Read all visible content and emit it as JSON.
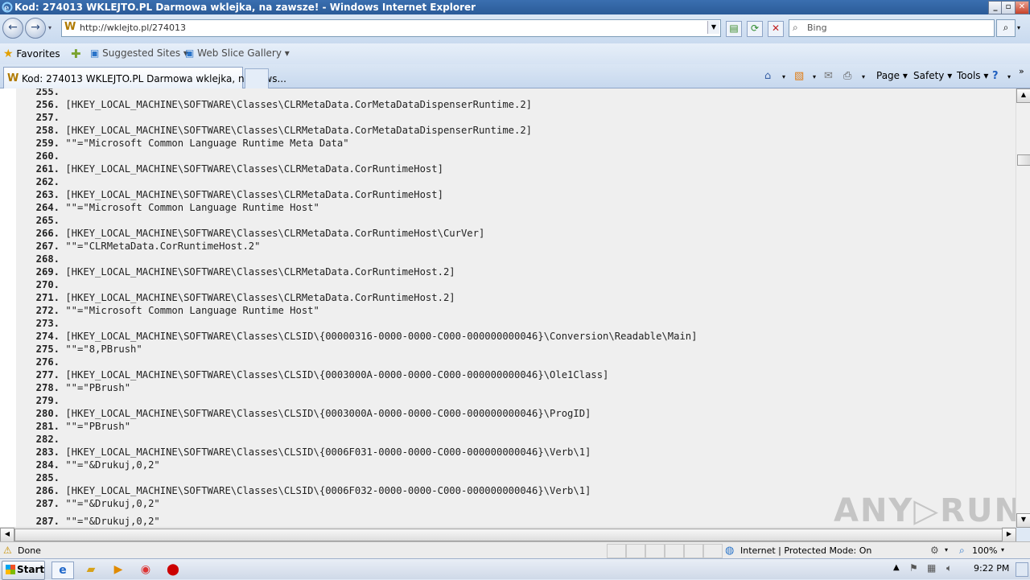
{
  "window": {
    "title": "Kod: 274013 WKLEJTO.PL Darmowa wklejka, na zawsze! - Windows Internet Explorer",
    "controls": [
      "_",
      "▫",
      "✕"
    ]
  },
  "address_bar": {
    "url": "http://wklejto.pl/274013",
    "search_placeholder": "Bing"
  },
  "favorites_bar": {
    "favorites_label": "Favorites",
    "suggested_sites_label": "Suggested Sites ▾",
    "web_slice_label": "Web Slice Gallery ▾"
  },
  "tabs": {
    "active_label": "Kod: 274013 WKLEJTO.PL Darmowa wklejka, na zaws..."
  },
  "command_bar": {
    "page_label": "Page ▾",
    "safety_label": "Safety ▾",
    "tools_label": "Tools ▾"
  },
  "code_lines": [
    {
      "num": "255.",
      "text": ""
    },
    {
      "num": "256.",
      "text": "[HKEY_LOCAL_MACHINE\\SOFTWARE\\Classes\\CLRMetaData.CorMetaDataDispenserRuntime.2]"
    },
    {
      "num": "257.",
      "text": ""
    },
    {
      "num": "258.",
      "text": "[HKEY_LOCAL_MACHINE\\SOFTWARE\\Classes\\CLRMetaData.CorMetaDataDispenserRuntime.2]"
    },
    {
      "num": "259.",
      "text": "\"\"=\"Microsoft Common Language Runtime Meta Data\""
    },
    {
      "num": "260.",
      "text": ""
    },
    {
      "num": "261.",
      "text": "[HKEY_LOCAL_MACHINE\\SOFTWARE\\Classes\\CLRMetaData.CorRuntimeHost]"
    },
    {
      "num": "262.",
      "text": ""
    },
    {
      "num": "263.",
      "text": "[HKEY_LOCAL_MACHINE\\SOFTWARE\\Classes\\CLRMetaData.CorRuntimeHost]"
    },
    {
      "num": "264.",
      "text": "\"\"=\"Microsoft Common Language Runtime Host\""
    },
    {
      "num": "265.",
      "text": ""
    },
    {
      "num": "266.",
      "text": "[HKEY_LOCAL_MACHINE\\SOFTWARE\\Classes\\CLRMetaData.CorRuntimeHost\\CurVer]"
    },
    {
      "num": "267.",
      "text": "\"\"=\"CLRMetaData.CorRuntimeHost.2\""
    },
    {
      "num": "268.",
      "text": ""
    },
    {
      "num": "269.",
      "text": "[HKEY_LOCAL_MACHINE\\SOFTWARE\\Classes\\CLRMetaData.CorRuntimeHost.2]"
    },
    {
      "num": "270.",
      "text": ""
    },
    {
      "num": "271.",
      "text": "[HKEY_LOCAL_MACHINE\\SOFTWARE\\Classes\\CLRMetaData.CorRuntimeHost.2]"
    },
    {
      "num": "272.",
      "text": "\"\"=\"Microsoft Common Language Runtime Host\""
    },
    {
      "num": "273.",
      "text": ""
    },
    {
      "num": "274.",
      "text": "[HKEY_LOCAL_MACHINE\\SOFTWARE\\Classes\\CLSID\\{00000316-0000-0000-C000-000000000046}\\Conversion\\Readable\\Main]"
    },
    {
      "num": "275.",
      "text": "\"\"=\"8,PBrush\""
    },
    {
      "num": "276.",
      "text": ""
    },
    {
      "num": "277.",
      "text": "[HKEY_LOCAL_MACHINE\\SOFTWARE\\Classes\\CLSID\\{0003000A-0000-0000-C000-000000000046}\\Ole1Class]"
    },
    {
      "num": "278.",
      "text": "\"\"=\"PBrush\""
    },
    {
      "num": "279.",
      "text": ""
    },
    {
      "num": "280.",
      "text": "[HKEY_LOCAL_MACHINE\\SOFTWARE\\Classes\\CLSID\\{0003000A-0000-0000-C000-000000000046}\\ProgID]"
    },
    {
      "num": "281.",
      "text": "\"\"=\"PBrush\""
    },
    {
      "num": "282.",
      "text": ""
    },
    {
      "num": "283.",
      "text": "[HKEY_LOCAL_MACHINE\\SOFTWARE\\Classes\\CLSID\\{0006F031-0000-0000-C000-000000000046}\\Verb\\1]"
    },
    {
      "num": "284.",
      "text": "\"\"=\"&Drukuj,0,2\""
    },
    {
      "num": "285.",
      "text": ""
    },
    {
      "num": "286.",
      "text": "[HKEY_LOCAL_MACHINE\\SOFTWARE\\Classes\\CLSID\\{0006F032-0000-0000-C000-000000000046}\\Verb\\1]"
    },
    {
      "num": "287.",
      "text": "\"\"=\"&Drukuj,0,2\""
    },
    {
      "num": "287.",
      "text": "\"\"=\"&Drukuj,0,2\""
    }
  ],
  "status_bar": {
    "status_text": "Done",
    "zone_text": "Internet | Protected Mode: On",
    "zoom_text": "100%"
  },
  "taskbar": {
    "start_label": "Start",
    "clock": "9:22 PM"
  },
  "watermark": "ANY▷RUN"
}
